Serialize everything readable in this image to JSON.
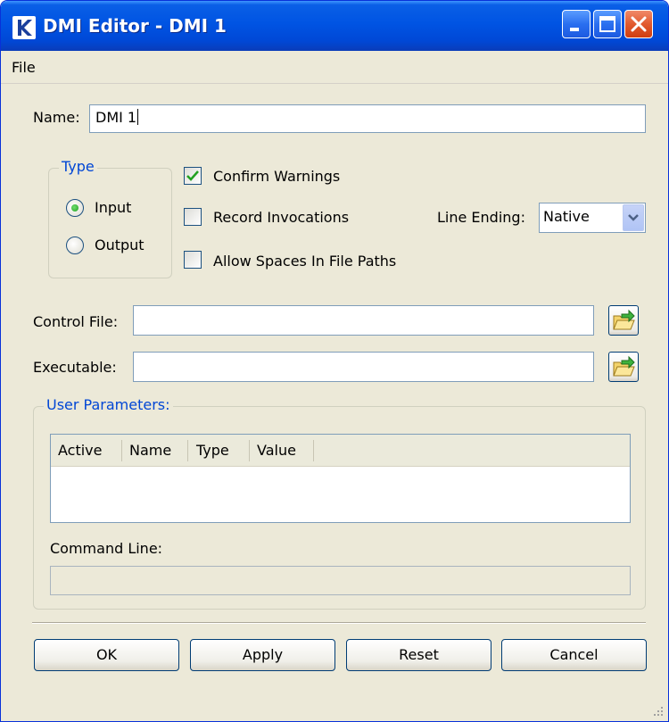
{
  "window": {
    "title": "DMI Editor - DMI 1"
  },
  "menu": {
    "file": "File"
  },
  "name_row": {
    "label": "Name:",
    "value": "DMI 1"
  },
  "type_group": {
    "title": "Type",
    "options": [
      {
        "label": "Input",
        "selected": true
      },
      {
        "label": "Output",
        "selected": false
      }
    ]
  },
  "options": {
    "confirm_warnings": {
      "label": "Confirm Warnings",
      "checked": true
    },
    "record_invocations": {
      "label": "Record Invocations",
      "checked": false
    },
    "allow_spaces": {
      "label": "Allow Spaces In File Paths",
      "checked": false
    }
  },
  "line_ending": {
    "label": "Line Ending:",
    "value": "Native"
  },
  "control_file": {
    "label": "Control File:",
    "value": ""
  },
  "executable": {
    "label": "Executable:",
    "value": ""
  },
  "user_parameters": {
    "title": "User Parameters:",
    "columns": [
      "Active",
      "Name",
      "Type",
      "Value"
    ],
    "rows": [],
    "command_line_label": "Command Line:",
    "command_line_value": ""
  },
  "buttons": {
    "ok": "OK",
    "apply": "Apply",
    "reset": "Reset",
    "cancel": "Cancel"
  },
  "colors": {
    "titlebar": "#0054e3",
    "group_title": "#0046d5",
    "window_bg": "#ece9d8"
  }
}
